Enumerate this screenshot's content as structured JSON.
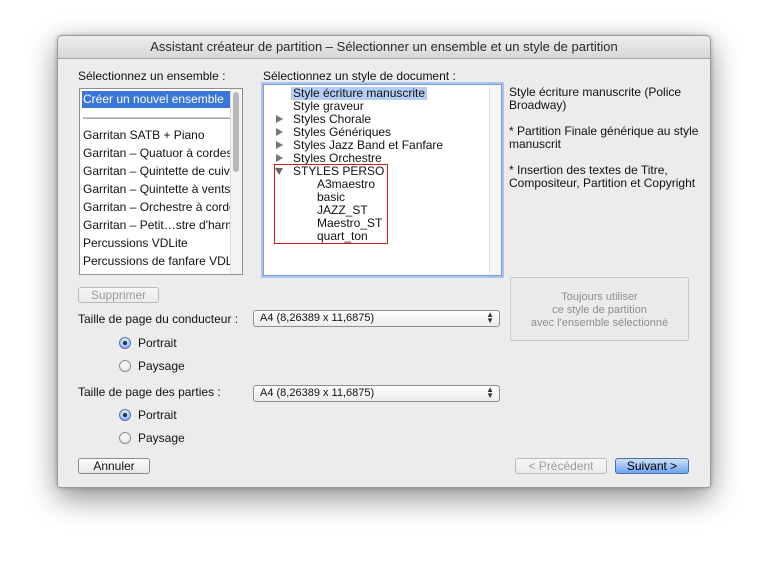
{
  "window": {
    "title": "Assistant créateur de partition – Sélectionner un ensemble et un style de partition"
  },
  "ensemble": {
    "label": "Sélectionnez un ensemble :",
    "items": [
      "Créer un nouvel ensemble",
      "——————————————",
      "Garritan SATB + Piano",
      "Garritan – Quatuor à cordes",
      "Garritan – Quintette de cuivres",
      "Garritan – Quintette à vents",
      "Garritan – Orchestre à cordes",
      "Garritan – Petit…stre d'harmonie",
      "Percussions VDLite",
      "Percussions de fanfare VDLite"
    ]
  },
  "document_style": {
    "label": "Sélectionnez un style de document :",
    "items": [
      "Style écriture manuscrite",
      "Style graveur",
      "Styles Chorale",
      "Styles Génériques",
      "Styles Jazz Band et Fanfare",
      "Styles Orchestre",
      "STYLES PERSO",
      "A3maestro",
      "basic",
      "JAZZ_ST",
      "Maestro_ST",
      "quart_ton"
    ]
  },
  "description": {
    "line1": "Style écriture manuscrite (Police Broadway)",
    "line2": "* Partition Finale générique au style manuscrit",
    "line3": "* Insertion des textes de Titre, Compositeur, Partition et Copyright"
  },
  "buttons": {
    "delete": "Supprimer",
    "always_use_1": "Toujours utiliser",
    "always_use_2": "ce style de partition",
    "always_use_3": "avec l'ensemble sélectionné",
    "cancel": "Annuler",
    "previous": "< Précédent",
    "next": "Suivant >"
  },
  "conductor": {
    "label": "Taille de page du conducteur :",
    "value": "A4 (8,26389 x 11,6875)",
    "portrait": "Portrait",
    "landscape": "Paysage",
    "orientation": "Portrait"
  },
  "parts": {
    "label": "Taille de page des parties :",
    "value": "A4 (8,26389 x 11,6875)",
    "portrait": "Portrait",
    "landscape": "Paysage",
    "orientation": "Portrait"
  },
  "colors": {
    "selection": "#3a75d8",
    "highlight": "#b3cdf4",
    "red_outline": "#d21818",
    "default_button": "#6ea4ee"
  }
}
